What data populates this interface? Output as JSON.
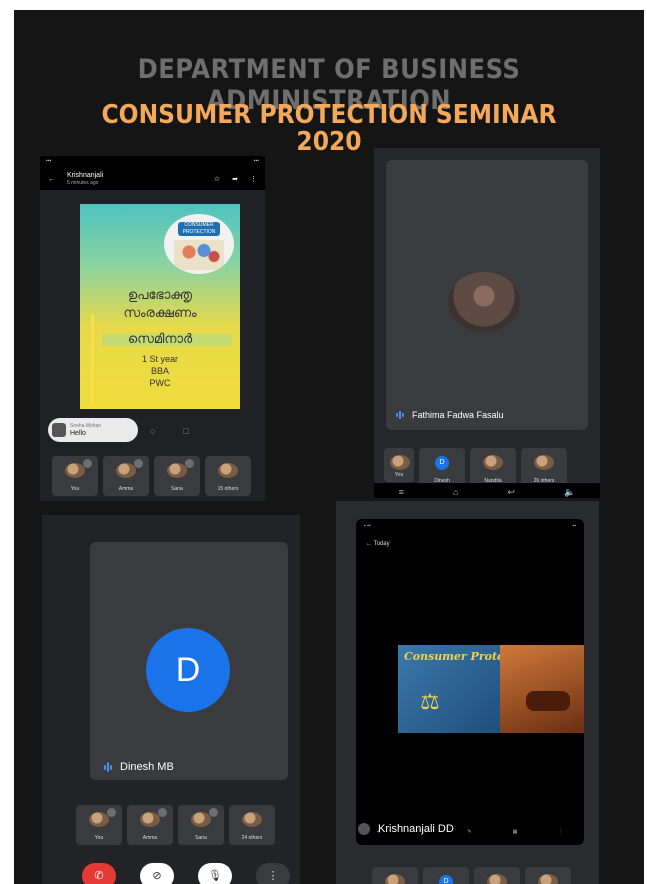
{
  "poster": {
    "department": "DEPARTMENT OF BUSINESS ADMINISTRATION",
    "title_line1": "CONSUMER PROTECTION SEMINAR",
    "title_line2": "2020"
  },
  "shot1": {
    "chat_name": "Krishnanjali",
    "chat_time": "5 minutes ago",
    "flyer": {
      "badge": "CONSUMER PROTECTION",
      "mal_line1": "ഉപഭോക്തൃ",
      "mal_line2": "സംരക്ഷണം",
      "mal_line3": "സെമിനാർ",
      "line4": "1 St year",
      "line5": "BBA",
      "line6": "PWC"
    },
    "toast_name": "Sneha Mohan",
    "toast_msg": "Hello",
    "tiles": [
      "You",
      "Amma",
      "Sana",
      "15 others"
    ]
  },
  "shot2": {
    "speaker": "Fathima Fadwa Fasalu",
    "tiles": [
      "You",
      "Dinesh",
      "Nandita",
      "26 others"
    ],
    "dinesh_initial": "D"
  },
  "shot3": {
    "initial": "D",
    "speaker": "Dinesh MB",
    "tiles": [
      "You",
      "Amma",
      "Sana",
      "24 others"
    ]
  },
  "shot4": {
    "header": "Today",
    "book_title": "Consumer Protection",
    "presenter": "Krishnanjali DD"
  },
  "colors": {
    "title_orange": "#f3a85a",
    "dept_gray": "#6e6e6e",
    "meet_blue": "#1a73e8",
    "end_red": "#e53935"
  }
}
